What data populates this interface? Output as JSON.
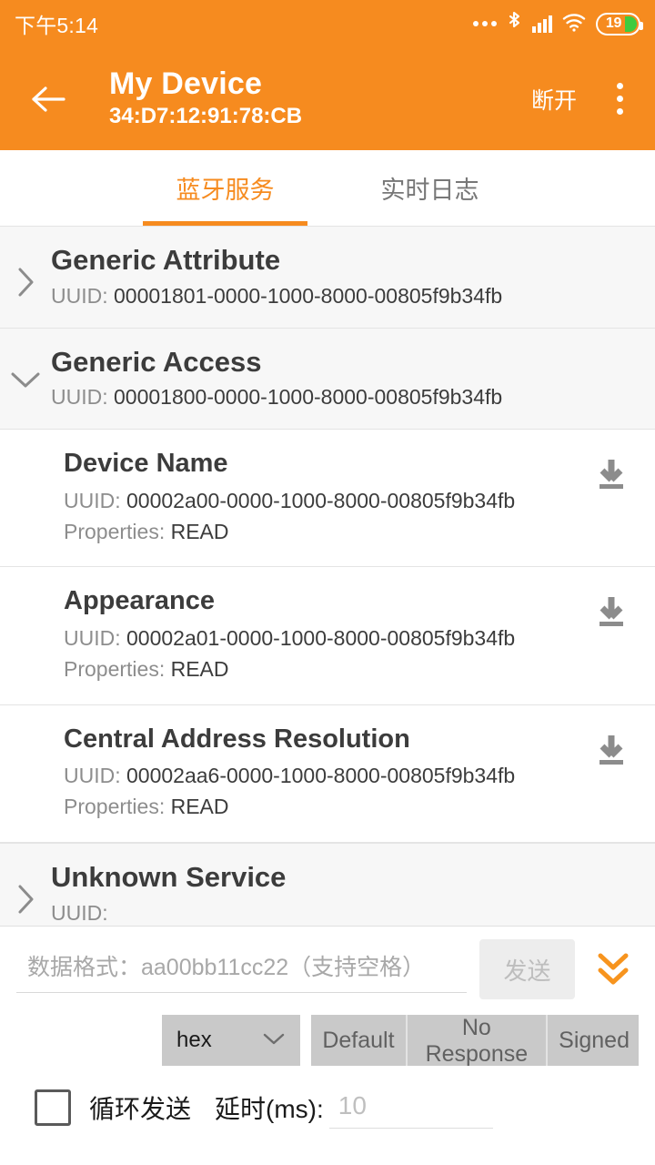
{
  "status_bar": {
    "clock": "下午5:14",
    "icons": [
      "more-dots-icon",
      "bluetooth-icon",
      "cellular-signal-icon",
      "wifi-icon"
    ],
    "battery_percent": "19"
  },
  "app_bar": {
    "back_icon": "back-arrow-icon",
    "title": "My Device",
    "subtitle": "34:D7:12:91:78:CB",
    "action_label": "断开",
    "overflow_icon": "kebab-menu-icon",
    "accent_color": "#F68B1F"
  },
  "tabs": [
    {
      "label": "蓝牙服务",
      "active": true
    },
    {
      "label": "实时日志",
      "active": false
    }
  ],
  "services": [
    {
      "name": "Generic Attribute",
      "uuid_label": "UUID:",
      "uuid": "00001801-0000-1000-8000-00805f9b34fb",
      "expanded": false,
      "chevron": "chevron-right-icon",
      "characteristics": []
    },
    {
      "name": "Generic Access",
      "uuid_label": "UUID:",
      "uuid": "00001800-0000-1000-8000-00805f9b34fb",
      "expanded": true,
      "chevron": "chevron-down-icon",
      "characteristics": [
        {
          "name": "Device Name",
          "uuid_label": "UUID:",
          "uuid": "00002a00-0000-1000-8000-00805f9b34fb",
          "properties_label": "Properties:",
          "properties": "READ",
          "action_icon": "download-icon"
        },
        {
          "name": "Appearance",
          "uuid_label": "UUID:",
          "uuid": "00002a01-0000-1000-8000-00805f9b34fb",
          "properties_label": "Properties:",
          "properties": "READ",
          "action_icon": "download-icon"
        },
        {
          "name": "Central Address Resolution",
          "uuid_label": "UUID:",
          "uuid": "00002aa6-0000-1000-8000-00805f9b34fb",
          "properties_label": "Properties:",
          "properties": "READ",
          "action_icon": "download-icon"
        }
      ]
    },
    {
      "name": "Unknown Service",
      "uuid_label": "UUID:",
      "uuid": "",
      "expanded": false,
      "chevron": "chevron-right-icon",
      "characteristics": []
    }
  ],
  "send_panel": {
    "data_input_value": "",
    "data_input_placeholder": "数据格式：aa00bb11cc22（支持空格）",
    "send_label": "发送",
    "send_enabled": false,
    "expand_icon": "double-chevron-down-icon",
    "format_select": {
      "value": "hex",
      "chevron": "chevron-down-icon"
    },
    "write_modes": [
      "Default",
      "No Response",
      "Signed"
    ],
    "loop_send": {
      "checked": false,
      "label": "循环发送"
    },
    "delay": {
      "label": "延时(ms):",
      "value": "",
      "placeholder": "10"
    }
  }
}
